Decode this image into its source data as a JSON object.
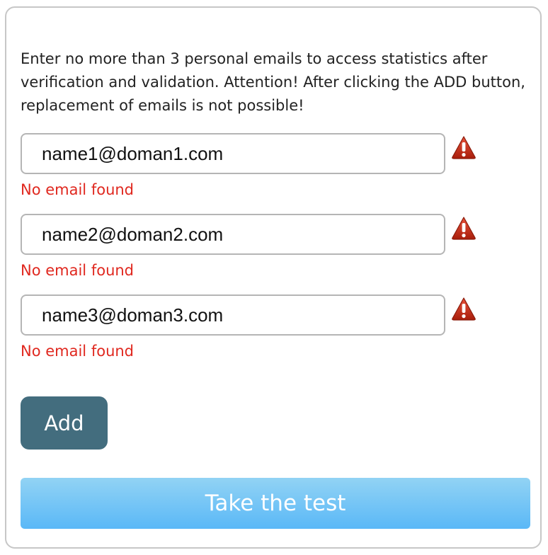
{
  "intro_text": "Enter no more than 3 personal emails to access statistics after verification and validation. Attention! After clicking the ADD button, replacement of emails is not possible!",
  "emails": [
    {
      "value": "name1@doman1.com",
      "error": "No email found",
      "icon": "warning-icon"
    },
    {
      "value": "name2@doman2.com",
      "error": "No email found",
      "icon": "warning-icon"
    },
    {
      "value": "name3@doman3.com",
      "error": "No email found",
      "icon": "warning-icon"
    }
  ],
  "add_button_label": "Add",
  "test_button_label": "Take the test",
  "colors": {
    "error_text": "#e0281f",
    "add_button": "#436d7e",
    "test_button_top": "#92d3f4",
    "test_button_bottom": "#5ab8f7",
    "warning_icon": "#c62a10"
  }
}
